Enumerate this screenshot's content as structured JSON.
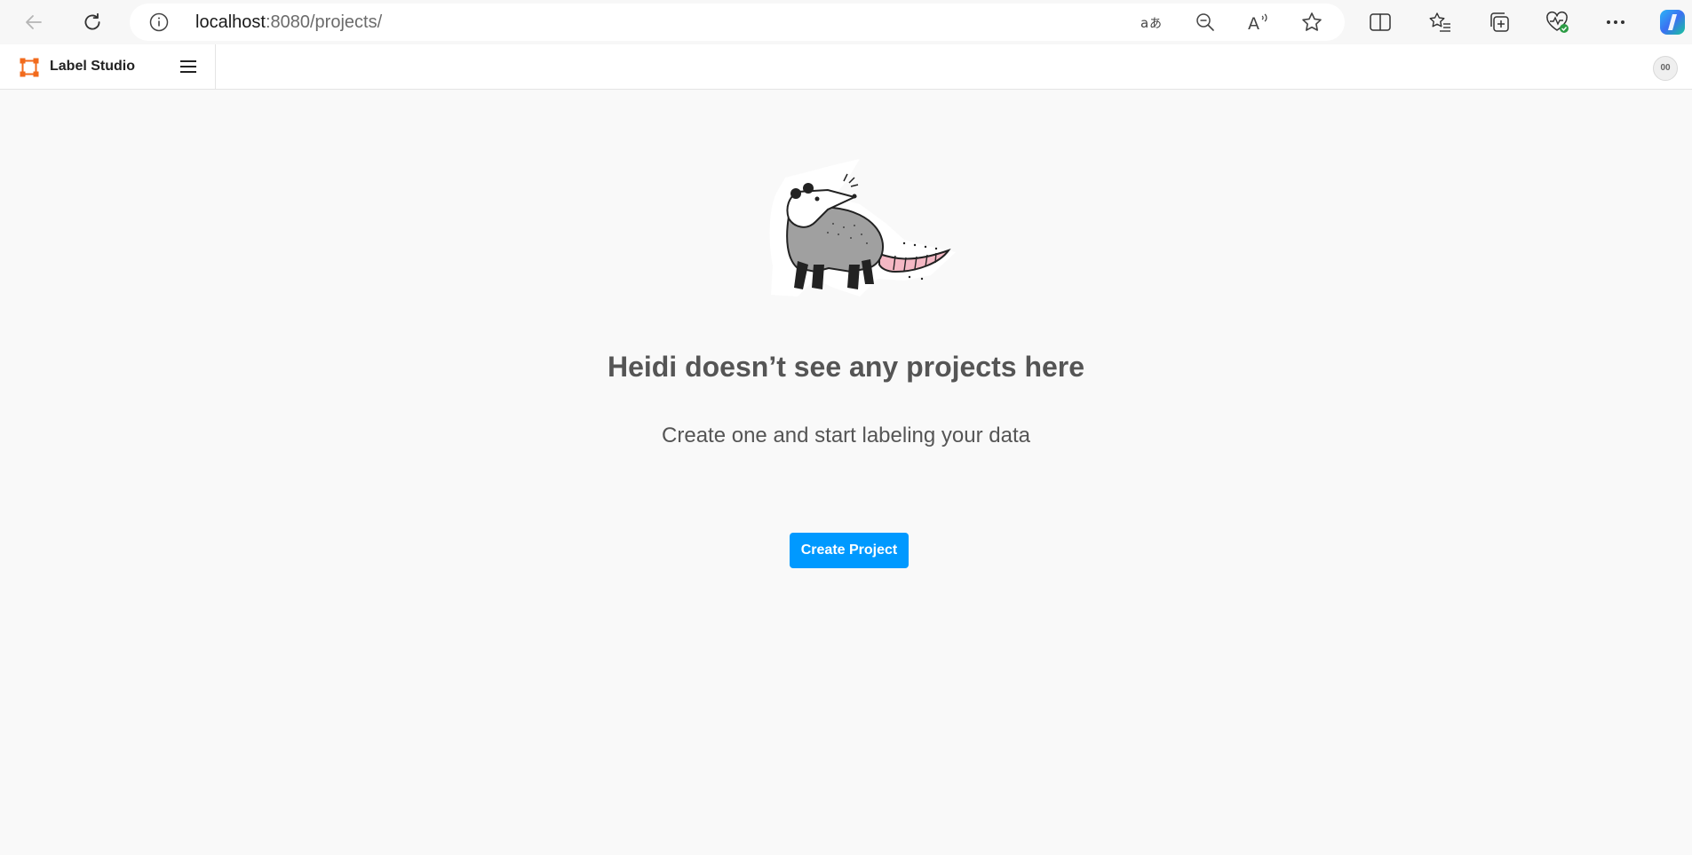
{
  "browser": {
    "url_host": "localhost",
    "url_rest": ":8080/projects/",
    "icons": [
      "back-arrow-icon",
      "reload-icon",
      "info-icon",
      "translate-icon",
      "zoom-out-icon",
      "read-aloud-icon",
      "favorite-star-icon",
      "split-screen-icon",
      "favorites-list-icon",
      "collections-icon",
      "browser-essentials-icon",
      "more-icon",
      "copilot-icon"
    ]
  },
  "header": {
    "brand_name": "Label Studio",
    "avatar_initials": "00",
    "accent_color": "#f26a1b"
  },
  "empty_state": {
    "title": "Heidi doesn’t see any projects here",
    "subtitle": "Create one and start labeling your data",
    "button_label": "Create Project",
    "button_color": "#0099ff"
  }
}
